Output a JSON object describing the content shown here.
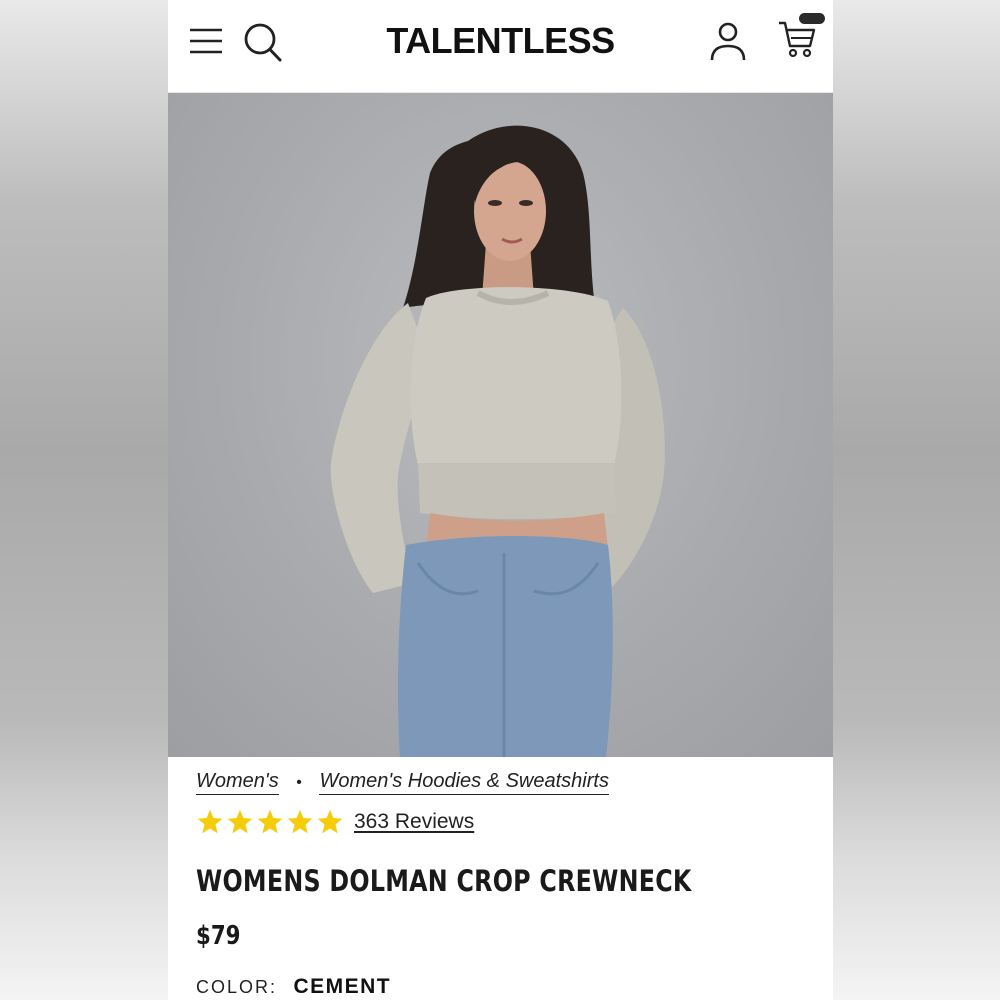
{
  "header": {
    "logo": "TALENTLESS",
    "icons": [
      "hamburger-menu-icon",
      "search-icon",
      "account-icon",
      "cart-icon"
    ]
  },
  "hero": {
    "image": "model-wearing-crop-crewneck"
  },
  "breadcrumb": {
    "items": [
      "Women's",
      "Women's Hoodies & Sweatshirts"
    ],
    "separator": "•"
  },
  "rating": {
    "stars": 5,
    "reviews_label": "363 Reviews",
    "star_color": "#f5cc0a"
  },
  "product": {
    "title": "WOMENS DOLMAN CROP CREWNECK",
    "price": "$79",
    "color_label": "COLOR:",
    "color_value": "CEMENT"
  }
}
